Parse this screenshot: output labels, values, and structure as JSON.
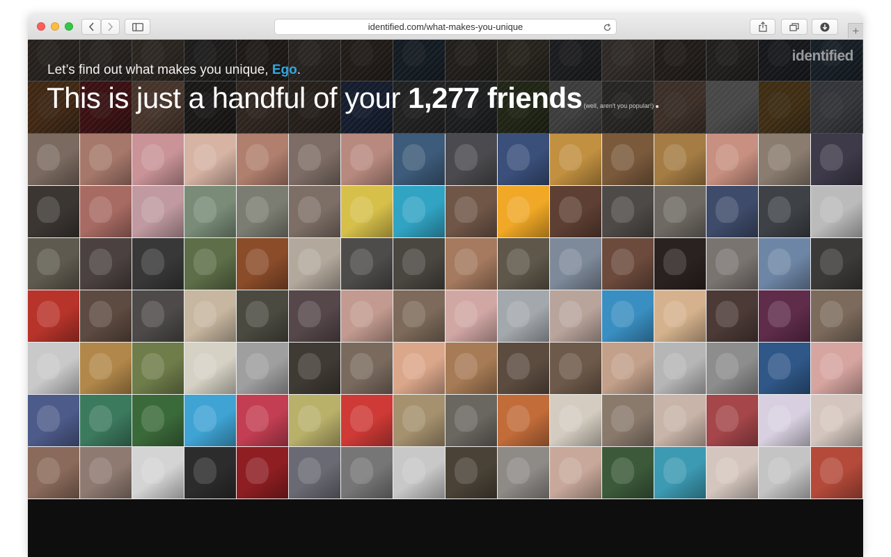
{
  "browser": {
    "url": "identified.com/what-makes-you-unique",
    "icons": [
      "back-icon",
      "forward-icon",
      "sidebar-icon",
      "reload-icon",
      "share-icon",
      "tabs-icon",
      "download-icon",
      "new-tab-icon"
    ]
  },
  "brand": {
    "logo_text": "identified"
  },
  "hero": {
    "greeting_prefix": "Let’s find out what makes you unique, ",
    "name": "Ego",
    "greeting_suffix": ".",
    "headline_prefix": "This is just a handful of your ",
    "friend_count": "1,277 friends",
    "aside": "(well, aren't you popular!)"
  },
  "photo_colors": [
    "#4a4038",
    "#3e3a36",
    "#56443a",
    "#2f2f33",
    "#5a4c44",
    "#3b3a38",
    "#454040",
    "#2e2b2b",
    "#3a3a3e",
    "#5b4b3a",
    "#4b4b4b",
    "#3e3b37",
    "#4c3f2c",
    "#3d3326",
    "#4c4c4e",
    "#2c2c30",
    "#6b5c4e",
    "#6e5d55",
    "#7d6956",
    "#4d4846",
    "#503f36",
    "#6b5f54",
    "#5e4a3c",
    "#2e4a63",
    "#5b4f45",
    "#6d6049",
    "#474a53",
    "#8c7b70",
    "#5c4a3f",
    "#59524d",
    "#363c4a",
    "#35506b",
    "#c9742d",
    "#b8222a",
    "#e0a07f",
    "#3f3a36",
    "#8e6a55",
    "#6e5747",
    "#2f4b8a",
    "#5a5a5f",
    "#4b4f55",
    "#596a34",
    "#bdbdbd",
    "#6d6a60",
    "#b98d74",
    "#e4e4e4",
    "#c7892d",
    "#9aa2b0",
    "#7b6a60",
    "#a6786b",
    "#c99397",
    "#d6b3a3",
    "#b07f6e",
    "#7e6d66",
    "#b88a7f",
    "#3d5b7a",
    "#4b4a4e",
    "#3a4f7a",
    "#c19040",
    "#7b5a3c",
    "#a47c44",
    "#c89080",
    "#8a7c6f",
    "#3e3a4a",
    "#3b3632",
    "#a86b63",
    "#c09aa0",
    "#7a8c78",
    "#7c7d72",
    "#7d6f66",
    "#d7c04a",
    "#31a4c4",
    "#6f5647",
    "#f0a826",
    "#5e3f33",
    "#4e4a47",
    "#6e6a63",
    "#3e4b6a",
    "#3e4246",
    "#bbbbbb",
    "#5e5a4f",
    "#4b4140",
    "#383838",
    "#5d6e48",
    "#8b4c2a",
    "#b3a89c",
    "#4e4c4a",
    "#4a4640",
    "#a57a5f",
    "#5f584a",
    "#7e8a9a",
    "#6c4a3c",
    "#2a2220",
    "#7a7470",
    "#6e86a6",
    "#3c3a38",
    "#b8342a",
    "#5d4a40",
    "#4d4a49",
    "#c7b6a0",
    "#4a4a40",
    "#56474a",
    "#c29a8f",
    "#7d6a5a",
    "#d1a7a4",
    "#a3a8ad",
    "#b9a49c",
    "#3a8fc2",
    "#d5b28d",
    "#4b3a36",
    "#5f2c4a",
    "#7c6a5c",
    "#c9c9c9",
    "#b2884a",
    "#6f7d4a",
    "#d5d1c4",
    "#9f9f9f",
    "#403a34",
    "#7a6a5e",
    "#dba78a",
    "#a77b55",
    "#5c4c40",
    "#6e5a4a",
    "#c2a08a",
    "#b6b6b6",
    "#8d8d8d",
    "#2f5787",
    "#d7a5a0",
    "#4d5b8a",
    "#3c7a5e",
    "#3b6a3a",
    "#3fa4d4",
    "#c33e52",
    "#b9b06a",
    "#cf3a36",
    "#a5916e",
    "#6a6660",
    "#c26c3a",
    "#d4ccc0",
    "#8a7a6c",
    "#c8b4a8",
    "#a4464a",
    "#d8d0e0",
    "#d4c6be",
    "#8a6a5a",
    "#8e7a70",
    "#d4d4d4",
    "#2c2c2c",
    "#8e1e22",
    "#6a6a74",
    "#767676",
    "#c8c8c8",
    "#4a4236",
    "#8e8a86",
    "#c8a89a",
    "#3c5a3a",
    "#3c9ab2",
    "#d4c6be",
    "#c4c4c4",
    "#b44a3a"
  ]
}
